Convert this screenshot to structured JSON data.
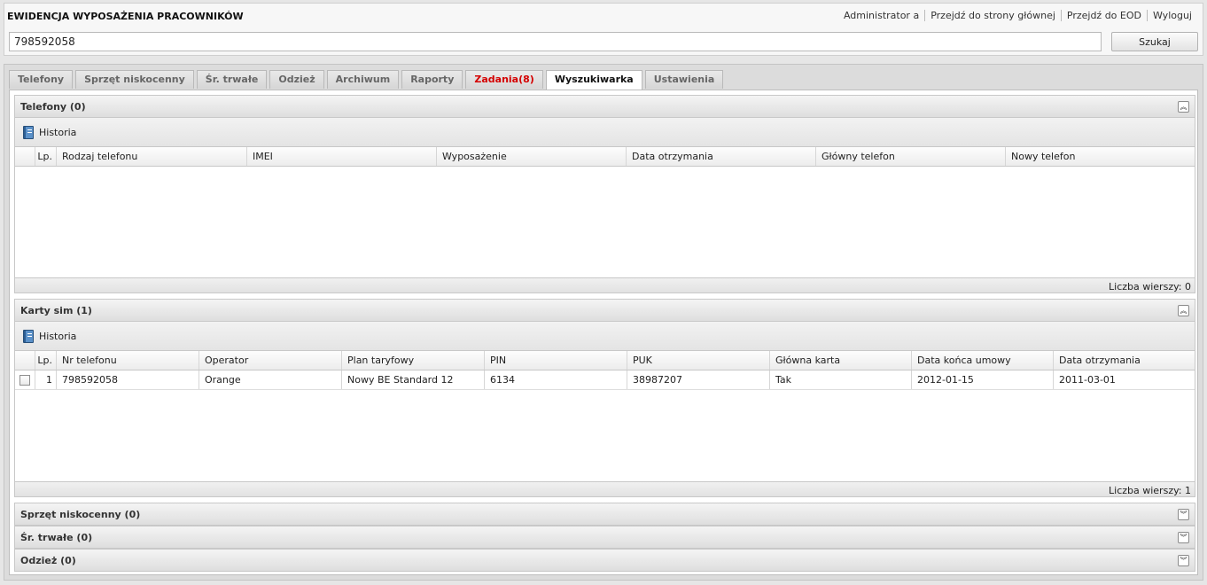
{
  "header": {
    "title": "EWIDENCJA WYPOSAŻENIA PRACOWNIKÓW",
    "links": [
      "Administrator a",
      "Przejdź do strony głównej",
      "Przejdź do EOD",
      "Wyloguj"
    ],
    "search_value": "798592058",
    "search_button": "Szukaj"
  },
  "tabs": [
    {
      "label": "Telefony",
      "state": "normal"
    },
    {
      "label": "Sprzęt niskocenny",
      "state": "normal"
    },
    {
      "label": "Śr. trwałe",
      "state": "normal"
    },
    {
      "label": "Odzież",
      "state": "normal"
    },
    {
      "label": "Archiwum",
      "state": "normal"
    },
    {
      "label": "Raporty",
      "state": "normal"
    },
    {
      "label": "Zadania(8)",
      "state": "alert"
    },
    {
      "label": "Wyszukiwarka",
      "state": "active"
    },
    {
      "label": "Ustawienia",
      "state": "normal"
    }
  ],
  "sections": {
    "phones": {
      "title": "Telefony (0)",
      "history_label": "Historia",
      "columns": [
        "Lp.",
        "Rodzaj telefonu",
        "IMEI",
        "Wyposażenie",
        "Data otrzymania",
        "Główny telefon",
        "Nowy telefon"
      ],
      "footer": "Liczba wierszy: 0"
    },
    "sims": {
      "title": "Karty sim (1)",
      "history_label": "Historia",
      "columns": [
        "Lp.",
        "Nr telefonu",
        "Operator",
        "Plan taryfowy",
        "PIN",
        "PUK",
        "Główna karta",
        "Data końca umowy",
        "Data otrzymania"
      ],
      "rows": [
        {
          "lp": "1",
          "nr": "798592058",
          "operator": "Orange",
          "plan": "Nowy BE Standard 12",
          "pin": "6134",
          "puk": "38987207",
          "glowna": "Tak",
          "koniec": "2012-01-15",
          "otrzymania": "2011-03-01"
        }
      ],
      "footer": "Liczba wierszy: 1"
    },
    "low_value": {
      "title": "Sprzęt niskocenny (0)"
    },
    "fixed_assets": {
      "title": "Śr. trwałe (0)"
    },
    "clothing": {
      "title": "Odzież (0)"
    }
  },
  "icons": {
    "collapse_up": "double-chevron-up-icon",
    "collapse_down": "double-chevron-down-icon",
    "history": "book-icon"
  },
  "colors": {
    "alert_tab": "#d40000",
    "history_icon": "#4a80bd"
  }
}
